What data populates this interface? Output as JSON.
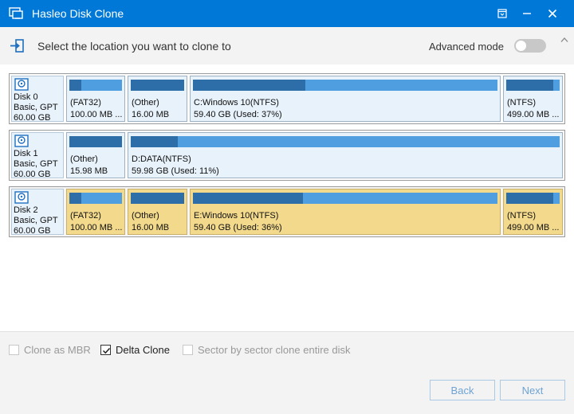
{
  "window": {
    "title": "Hasleo Disk Clone",
    "title_bar_color": "#0078d7"
  },
  "header": {
    "instruction": "Select the location you want to clone to",
    "advanced_mode_label": "Advanced mode",
    "advanced_mode_on": false
  },
  "disks": [
    {
      "name": "Disk 0",
      "type": "Basic, GPT",
      "size": "60.00 GB",
      "partitions": [
        {
          "label": "(FAT32)",
          "size": "100.00 MB ...",
          "used_fraction": 0.22
        },
        {
          "label": "(Other)",
          "size": "16.00 MB",
          "used_fraction": 1.0
        },
        {
          "label": "C:Windows 10(NTFS)",
          "size": "59.40 GB (Used: 37%)",
          "used_fraction": 0.37
        },
        {
          "label": "(NTFS)",
          "size": "499.00 MB ...",
          "used_fraction": 0.88
        }
      ]
    },
    {
      "name": "Disk 1",
      "type": "Basic, GPT",
      "size": "60.00 GB",
      "partitions": [
        {
          "label": "(Other)",
          "size": "15.98 MB",
          "used_fraction": 1.0
        },
        {
          "label": "D:DATA(NTFS)",
          "size": "59.98 GB (Used: 11%)",
          "used_fraction": 0.11
        }
      ]
    },
    {
      "name": "Disk 2",
      "type": "Basic, GPT",
      "size": "60.00 GB",
      "selected": true,
      "highlight_color": "#f2d98c",
      "partitions": [
        {
          "label": "(FAT32)",
          "size": "100.00 MB ...",
          "used_fraction": 0.22
        },
        {
          "label": "(Other)",
          "size": "16.00 MB",
          "used_fraction": 1.0
        },
        {
          "label": "E:Windows 10(NTFS)",
          "size": "59.40 GB (Used: 36%)",
          "used_fraction": 0.36
        },
        {
          "label": "(NTFS)",
          "size": "499.00 MB ...",
          "used_fraction": 0.88
        }
      ]
    }
  ],
  "options": {
    "clone_as_mbr": {
      "label": "Clone as MBR",
      "checked": false,
      "enabled": false
    },
    "delta_clone": {
      "label": "Delta Clone",
      "checked": true,
      "enabled": true
    },
    "sector_clone": {
      "label": "Sector by sector clone entire disk",
      "checked": false,
      "enabled": false
    }
  },
  "footer": {
    "back_label": "Back",
    "next_label": "Next"
  },
  "colors": {
    "used_bar": "#2d6da8",
    "free_bar": "#4e9ee0",
    "partition_bg": "#e8f2fb",
    "selected_partition_bg": "#f2d98c"
  }
}
